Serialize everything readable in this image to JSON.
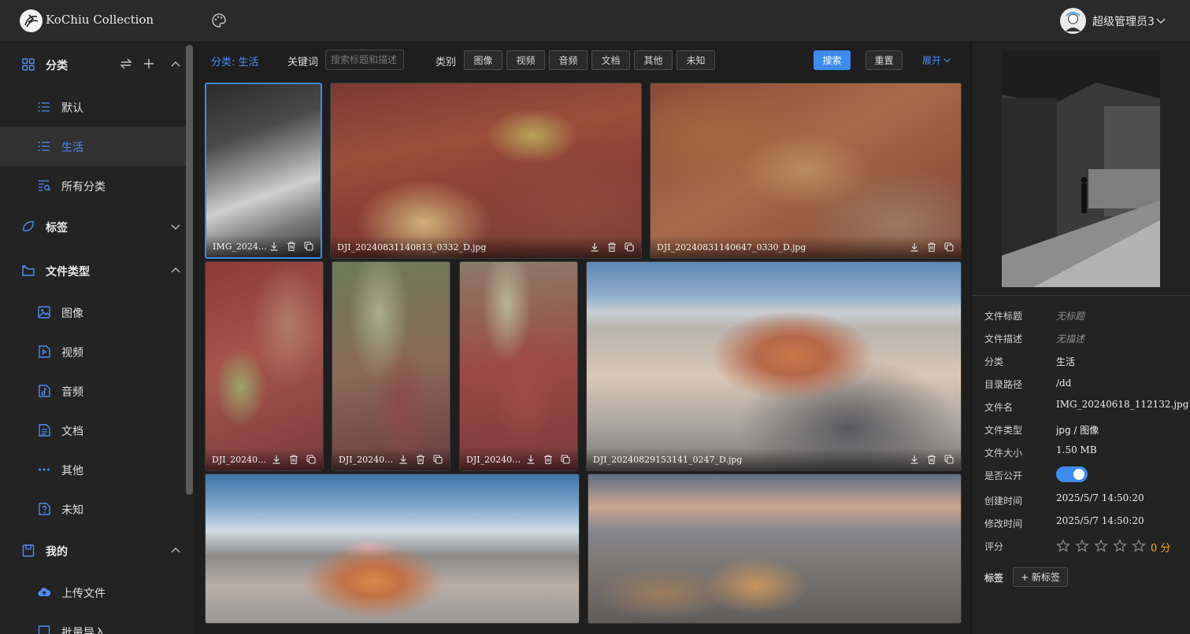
{
  "header": {
    "app_title": "KoChiu Collection",
    "user_name": "超级管理员3"
  },
  "sidebar": {
    "groups": [
      {
        "label": "分类",
        "icon": "grid-icon",
        "expanded": true
      },
      {
        "label": "标签",
        "icon": "tag-icon",
        "expanded": false
      },
      {
        "label": "文件类型",
        "icon": "folder-icon",
        "expanded": true
      },
      {
        "label": "我的",
        "icon": "save-icon",
        "expanded": true
      }
    ],
    "category_items": [
      {
        "label": "默认",
        "icon": "list-icon"
      },
      {
        "label": "生活",
        "icon": "list-icon",
        "active": true
      },
      {
        "label": "所有分类",
        "icon": "list-search-icon"
      }
    ],
    "filetype_items": [
      {
        "label": "图像",
        "icon": "image-icon"
      },
      {
        "label": "视频",
        "icon": "video-icon"
      },
      {
        "label": "音频",
        "icon": "audio-icon"
      },
      {
        "label": "文档",
        "icon": "document-icon"
      },
      {
        "label": "其他",
        "icon": "more-icon"
      },
      {
        "label": "未知",
        "icon": "unknown-file-icon"
      }
    ],
    "my_items": [
      {
        "label": "上传文件",
        "icon": "cloud-upload-icon"
      },
      {
        "label": "批量导入",
        "icon": "import-icon"
      }
    ]
  },
  "filter": {
    "category_title": "分类: 生活",
    "keyword_label": "关键词",
    "keyword_placeholder": "搜索标题和描述",
    "type_label": "类别",
    "types": [
      "图像",
      "视频",
      "音频",
      "文档",
      "其他",
      "未知"
    ],
    "search_label": "搜索",
    "reset_label": "重置",
    "expand_label": "展开"
  },
  "gallery": {
    "files": [
      {
        "name": "IMG_20240…",
        "style": "bw",
        "selected": true
      },
      {
        "name": "DJI_20240831140813_0332_D.jpg",
        "style": "red1"
      },
      {
        "name": "DJI_20240831140647_0330_D.jpg",
        "style": "red2"
      },
      {
        "name": "DJI_202408…",
        "style": "red3"
      },
      {
        "name": "DJI_202408…",
        "style": "green"
      },
      {
        "name": "DJI_202408…",
        "style": "red4"
      },
      {
        "name": "DJI_20240829153141_0247_D.jpg",
        "style": "mesa"
      },
      {
        "name": "",
        "style": "mesa2"
      },
      {
        "name": "",
        "style": "desert"
      }
    ]
  },
  "details": {
    "title_label": "文件标题",
    "title_value": "无标题",
    "desc_label": "文件描述",
    "desc_value": "无描述",
    "category_label": "分类",
    "category_value": "生活",
    "path_label": "目录路径",
    "path_value": "/dd",
    "filename_label": "文件名",
    "filename_value": "IMG_20240618_112132.jpg",
    "filetype_label": "文件类型",
    "filetype_value": "jpg / 图像",
    "size_label": "文件大小",
    "size_value": "1.50 MB",
    "public_label": "是否公开",
    "public_value": true,
    "created_label": "创建时间",
    "created_value": "2025/5/7 14:50:20",
    "modified_label": "修改时间",
    "modified_value": "2025/5/7 14:50:20",
    "rating_label": "评分",
    "rating_value": 0,
    "rating_max": 5,
    "rating_text": "0 分",
    "tags_label": "标签",
    "new_tag_label": "+ 新标签"
  },
  "colors": {
    "accent": "#3d8cf0",
    "background": "#1e1e1f",
    "panel": "#232324",
    "rating": "#f5a623"
  }
}
